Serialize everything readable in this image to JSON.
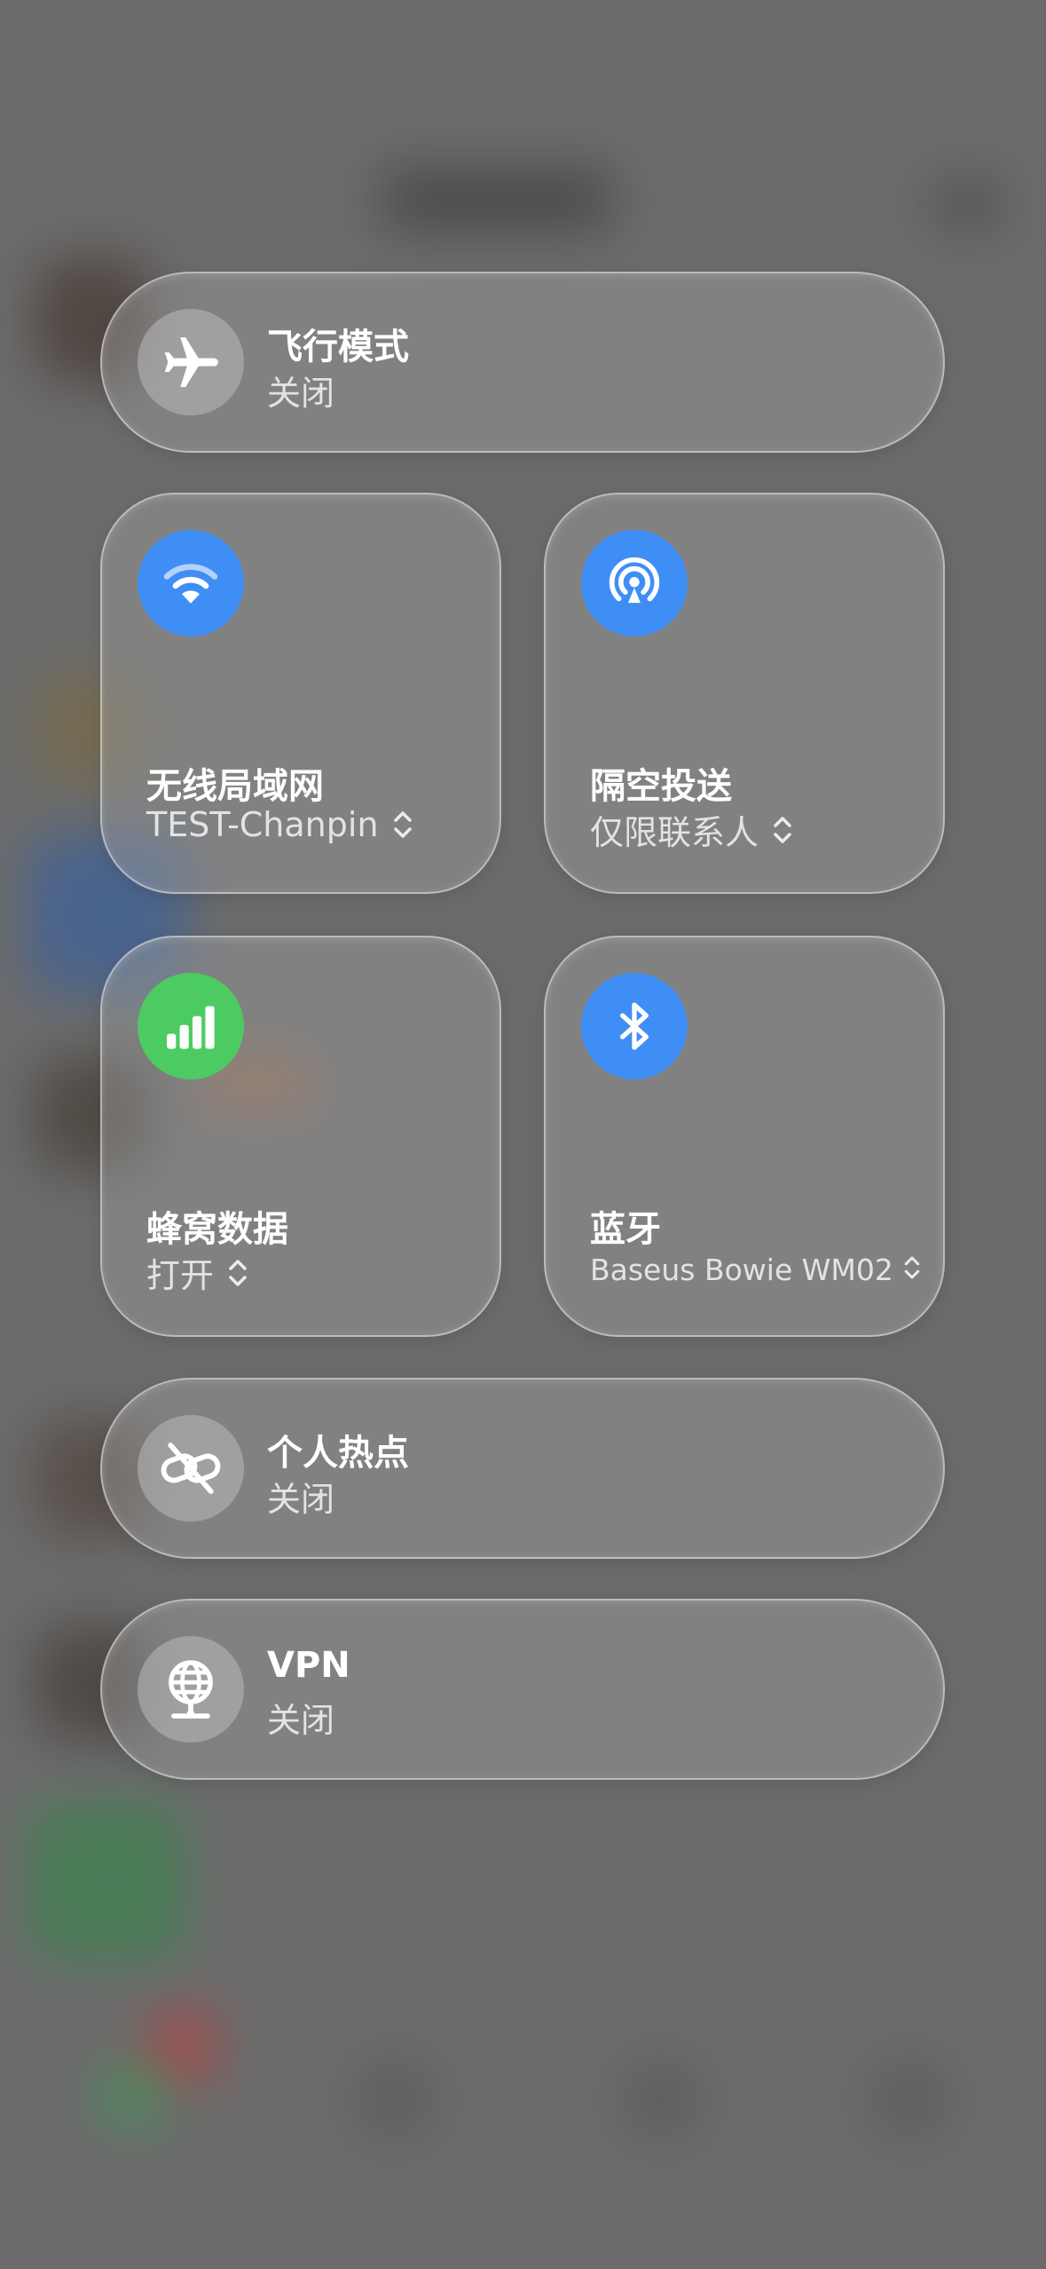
{
  "controls": {
    "airplane": {
      "title": "飞行模式",
      "status": "关闭",
      "icon": "airplane-icon"
    },
    "wifi": {
      "title": "无线局域网",
      "network": "TEST-Chanpin",
      "icon": "wifi-icon",
      "color": "#3f8ef5"
    },
    "airdrop": {
      "title": "隔空投送",
      "mode": "仅限联系人",
      "icon": "airdrop-icon",
      "color": "#3f8ef5"
    },
    "cellular": {
      "title": "蜂窝数据",
      "status": "打开",
      "icon": "cellular-bars-icon",
      "color": "#4ccb62"
    },
    "bluetooth": {
      "title": "蓝牙",
      "device": "Baseus Bowie WM02",
      "icon": "bluetooth-icon",
      "color": "#3f8ef5"
    },
    "hotspot": {
      "title": "个人热点",
      "status": "关闭",
      "icon": "hotspot-link-icon"
    },
    "vpn": {
      "title": "VPN",
      "status": "关闭",
      "icon": "vpn-globe-icon"
    }
  }
}
